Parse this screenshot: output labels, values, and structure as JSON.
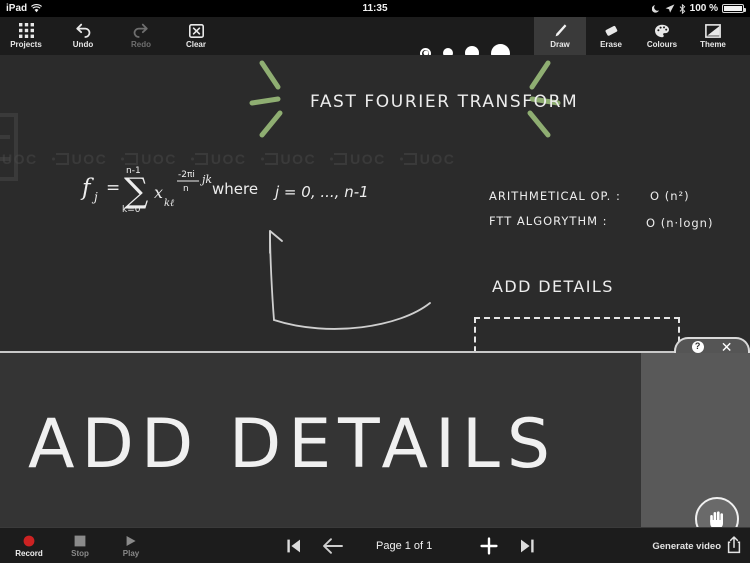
{
  "status_bar": {
    "device": "iPad",
    "wifi_icon": "wifi-icon",
    "time": "11:35",
    "moon_icon": "moon-icon",
    "location_icon": "location-arrow-icon",
    "bluetooth_icon": "bluetooth-icon",
    "battery_percent": "100 %",
    "battery_icon": "battery-full-icon"
  },
  "toolbar": {
    "projects": {
      "label": "Projects",
      "icon": "grid-icon"
    },
    "undo": {
      "label": "Undo",
      "icon": "undo-arrow-icon"
    },
    "redo": {
      "label": "Redo",
      "icon": "redo-arrow-icon"
    },
    "clear": {
      "label": "Clear",
      "icon": "clear-x-icon"
    },
    "draw": {
      "label": "Draw",
      "icon": "pencil-icon"
    },
    "erase": {
      "label": "Erase",
      "icon": "eraser-icon"
    },
    "colours": {
      "label": "Colours",
      "icon": "palette-icon"
    },
    "theme": {
      "label": "Theme",
      "icon": "theme-contrast-icon"
    },
    "brush_sizes": [
      {
        "name": "brush-size-1",
        "diameter": 11,
        "selected": true
      },
      {
        "name": "brush-size-2",
        "diameter": 10,
        "selected": false
      },
      {
        "name": "brush-size-3",
        "diameter": 14,
        "selected": false
      },
      {
        "name": "brush-size-4",
        "diameter": 19,
        "selected": false
      }
    ]
  },
  "board": {
    "background": "#2b2b2b",
    "title": "FAST FOURIER TRANSFORM",
    "accent_color": "#8fae72",
    "ink_color": "#ededed",
    "watermark_text": "UOC",
    "watermark_repeat": 7,
    "formula": {
      "lhs": "f",
      "lhs_sub": "j",
      "eq": "=",
      "sum_upper": "n-1",
      "sum_lower": "k=0",
      "term": "x",
      "term_sub": "kℓ",
      "exp_num": "-2πi",
      "exp_den": "n",
      "exp_tail": "jk",
      "where": "where",
      "range": "j = 0, ..., n-1"
    },
    "complexity": [
      {
        "label": "ARITHMETICAL OP. :",
        "value": "O (n²)"
      },
      {
        "label": "FTT ALGORYTHM :",
        "value": "O (n·logn)"
      }
    ],
    "selection": {
      "text": "ADD   DETAILS",
      "selected": true
    }
  },
  "panel_tab": {
    "help_icon": "question-mark-icon",
    "help_label": "?",
    "close_icon": "close-x-icon",
    "close_label": "✕"
  },
  "preview": {
    "text": "ADD      DETAILS",
    "hand_tool_icon": "hand-palm-icon"
  },
  "bottom_bar": {
    "record": {
      "label": "Record",
      "icon": "record-dot-icon"
    },
    "stop": {
      "label": "Stop",
      "icon": "stop-square-icon"
    },
    "play": {
      "label": "Play",
      "icon": "play-triangle-icon"
    },
    "first_page": {
      "name": "first-page-button",
      "icon": "skip-to-start-icon"
    },
    "prev_page": {
      "name": "previous-page-button",
      "icon": "arrow-left-icon"
    },
    "page_label": "Page 1 of 1",
    "add_page": {
      "name": "add-page-button",
      "icon": "plus-icon"
    },
    "last_page": {
      "name": "last-page-button",
      "icon": "skip-to-end-icon"
    },
    "generate_video": {
      "label": "Generate video",
      "icon": "share-upload-icon"
    }
  }
}
